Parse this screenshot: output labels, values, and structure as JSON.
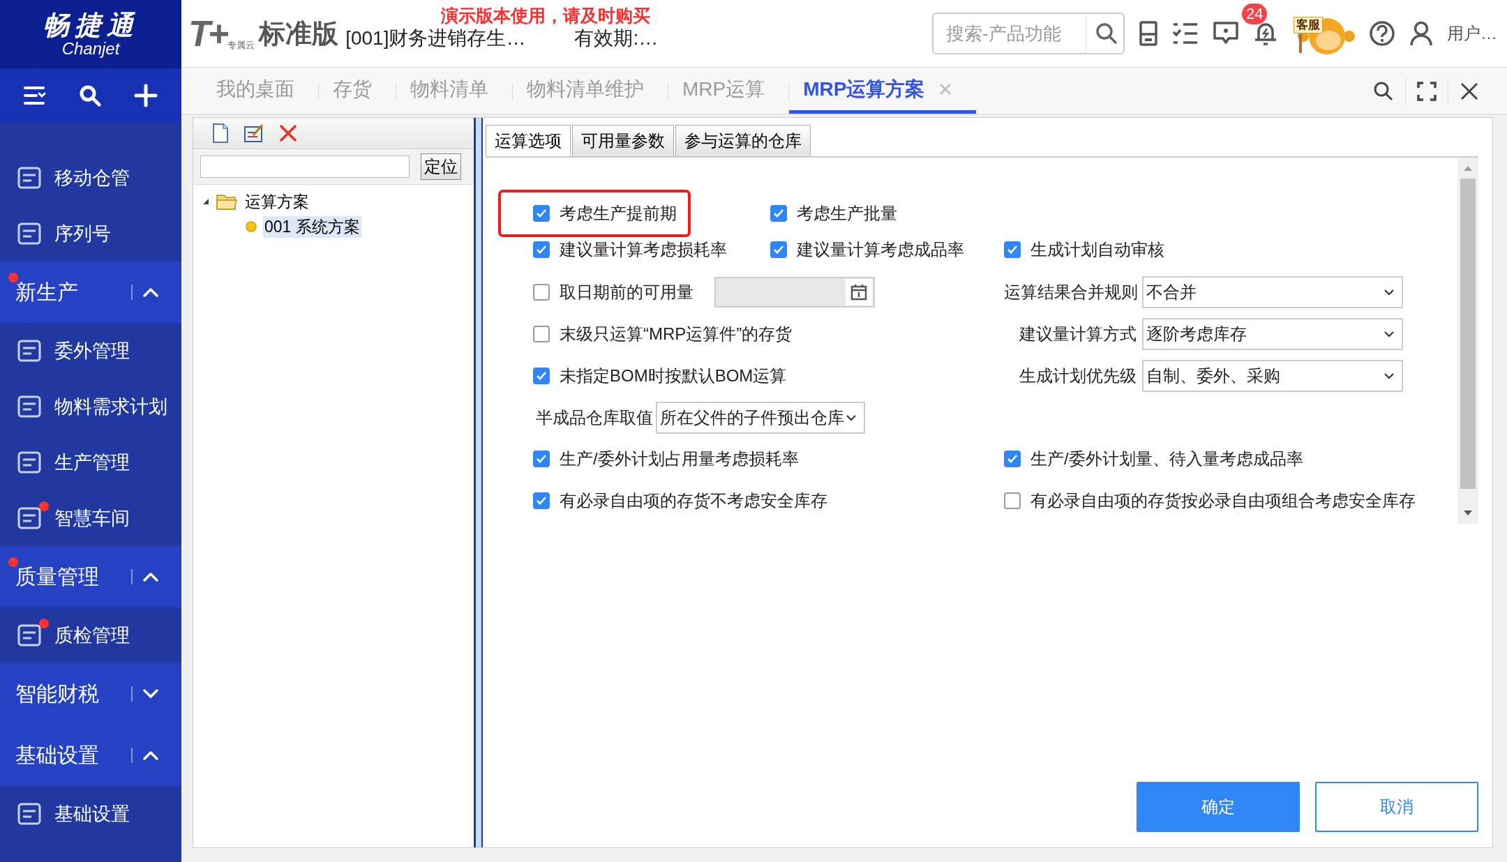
{
  "app": {
    "logo_cn": "畅捷通",
    "logo_en": "Chanjet",
    "product_mark": "T+",
    "product_sub": "专属云",
    "edition": "标准版",
    "account": "[001]财务进销存生…",
    "validity": "有效期:…",
    "notice": "演示版本使用，请及时购买"
  },
  "search": {
    "placeholder": "搜索-产品功能"
  },
  "notification_count": "24",
  "service_label": "客服",
  "user": "用户…",
  "sidebar": [
    {
      "kind": "item",
      "label": "移动仓管",
      "dot": false
    },
    {
      "kind": "item",
      "label": "序列号",
      "dot": false
    },
    {
      "kind": "group",
      "label": "新生产",
      "dot": true,
      "expanded": true
    },
    {
      "kind": "item",
      "label": "委外管理",
      "dot": false
    },
    {
      "kind": "item",
      "label": "物料需求计划",
      "dot": false
    },
    {
      "kind": "item",
      "label": "生产管理",
      "dot": false
    },
    {
      "kind": "item",
      "label": "智慧车间",
      "dot": true
    },
    {
      "kind": "group",
      "label": "质量管理",
      "dot": true,
      "expanded": true
    },
    {
      "kind": "item",
      "label": "质检管理",
      "dot": true
    },
    {
      "kind": "group",
      "label": "智能财税",
      "dot": false,
      "expanded": false
    },
    {
      "kind": "group",
      "label": "基础设置",
      "dot": false,
      "expanded": true
    },
    {
      "kind": "item",
      "label": "基础设置",
      "dot": false
    }
  ],
  "tabs": [
    {
      "label": "我的桌面",
      "selected": false,
      "closable": false
    },
    {
      "label": "存货",
      "selected": false,
      "closable": false
    },
    {
      "label": "物料清单",
      "selected": false,
      "closable": false
    },
    {
      "label": "物料清单维护",
      "selected": false,
      "closable": false
    },
    {
      "label": "MRP运算",
      "selected": false,
      "closable": false
    },
    {
      "label": "MRP运算方案",
      "selected": true,
      "closable": true
    }
  ],
  "locate_button": "定位",
  "tree": [
    {
      "label": "运算方案",
      "expanded": true,
      "children": [
        {
          "label": "001 系统方案",
          "selected": true
        }
      ]
    }
  ],
  "inner_tabs": [
    {
      "label": "运算选项",
      "selected": true
    },
    {
      "label": "可用量参数",
      "selected": false
    },
    {
      "label": "参与运算的仓库",
      "selected": false
    }
  ],
  "form_rows": [
    [
      {
        "kind": "checkbox",
        "label": "考虑生产提前期",
        "checked": true,
        "highlighted": true
      },
      {
        "kind": "checkbox",
        "label": "考虑生产批量",
        "checked": true,
        "highlighted": false
      }
    ],
    [
      {
        "kind": "checkbox",
        "label": "建议量计算考虑损耗率",
        "checked": true,
        "highlighted": false
      },
      {
        "kind": "checkbox",
        "label": "建议量计算考虑成品率",
        "checked": true,
        "highlighted": false
      },
      {
        "kind": "checkbox",
        "label": "生成计划自动审核",
        "checked": true,
        "highlighted": false
      }
    ],
    [
      {
        "kind": "checkbox_date",
        "label": "取日期前的可用量",
        "checked": false,
        "highlighted": false
      },
      {
        "kind": "select",
        "label": "运算结果合并规则",
        "value": "不合并"
      }
    ],
    [
      {
        "kind": "checkbox",
        "label": "末级只运算“MRP运算件”的存货",
        "checked": false,
        "highlighted": false
      },
      {
        "kind": "select",
        "label": "建议量计算方式",
        "value": "逐阶考虑库存"
      }
    ],
    [
      {
        "kind": "checkbox",
        "label": "未指定BOM时按默认BOM运算",
        "checked": true,
        "highlighted": false
      },
      {
        "kind": "select",
        "label": "生成计划优先级",
        "value": "自制、委外、采购"
      }
    ],
    [
      {
        "kind": "select_inline",
        "label": "半成品仓库取值",
        "value": "所在父件的子件预出仓库"
      }
    ],
    [
      {
        "kind": "checkbox",
        "label": "生产/委外计划占用量考虑损耗率",
        "checked": true,
        "highlighted": false
      },
      {
        "kind": "checkbox",
        "label": "生产/委外计划量、待入量考虑成品率",
        "checked": true,
        "highlighted": false
      }
    ],
    [
      {
        "kind": "checkbox",
        "label": "有必录自由项的存货不考虑安全库存",
        "checked": true,
        "highlighted": false
      },
      {
        "kind": "checkbox",
        "label": "有必录自由项的存货按必录自由项组合考虑安全库存",
        "checked": false,
        "highlighted": false
      }
    ]
  ],
  "buttons": [
    {
      "label": "确定",
      "kind": "primary"
    },
    {
      "label": "取消",
      "kind": "secondary"
    }
  ]
}
